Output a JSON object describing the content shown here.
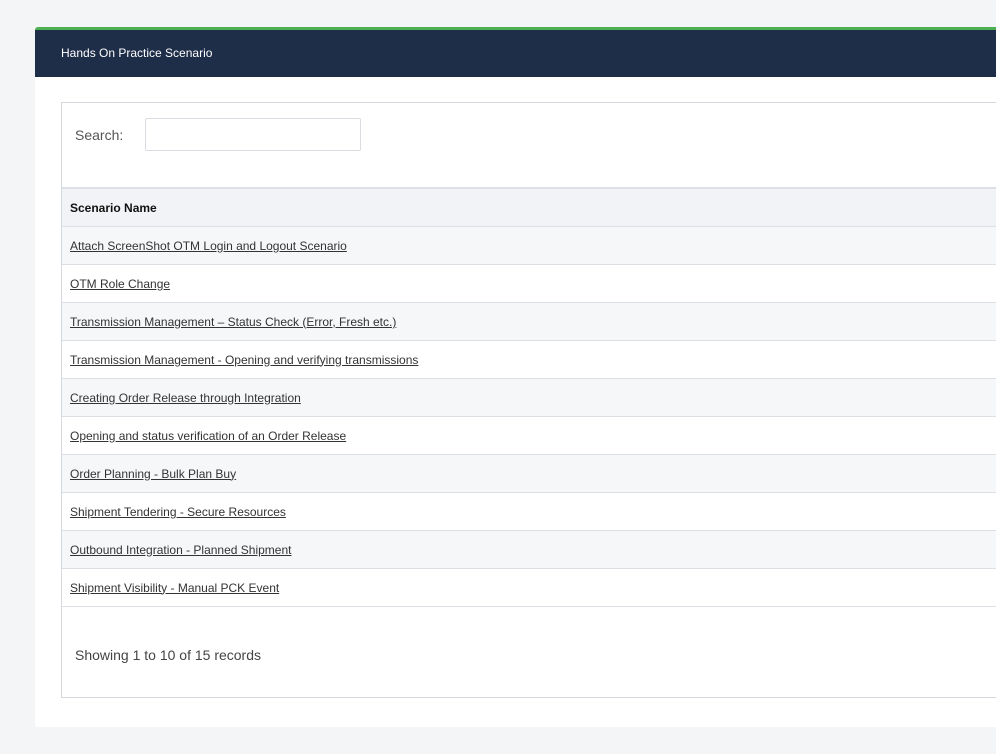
{
  "panel": {
    "title": "Hands On Practice Scenario",
    "accent_color": "#4caf50",
    "header_color": "#1e2d48"
  },
  "search": {
    "label": "Search:",
    "value": ""
  },
  "table": {
    "column_header": "Scenario Name",
    "rows": [
      "Attach ScreenShot OTM Login and Logout Scenario",
      "OTM Role Change",
      "Transmission Management – Status Check (Error, Fresh etc.)",
      "Transmission Management - Opening and verifying transmissions",
      "Creating Order Release through Integration",
      "Opening and status verification of an Order Release",
      "Order Planning - Bulk Plan Buy",
      "Shipment Tendering - Secure Resources",
      "Outbound Integration - Planned Shipment",
      "Shipment Visibility - Manual PCK Event"
    ]
  },
  "footer": {
    "records_info": "Showing 1 to 10 of 15 records"
  }
}
